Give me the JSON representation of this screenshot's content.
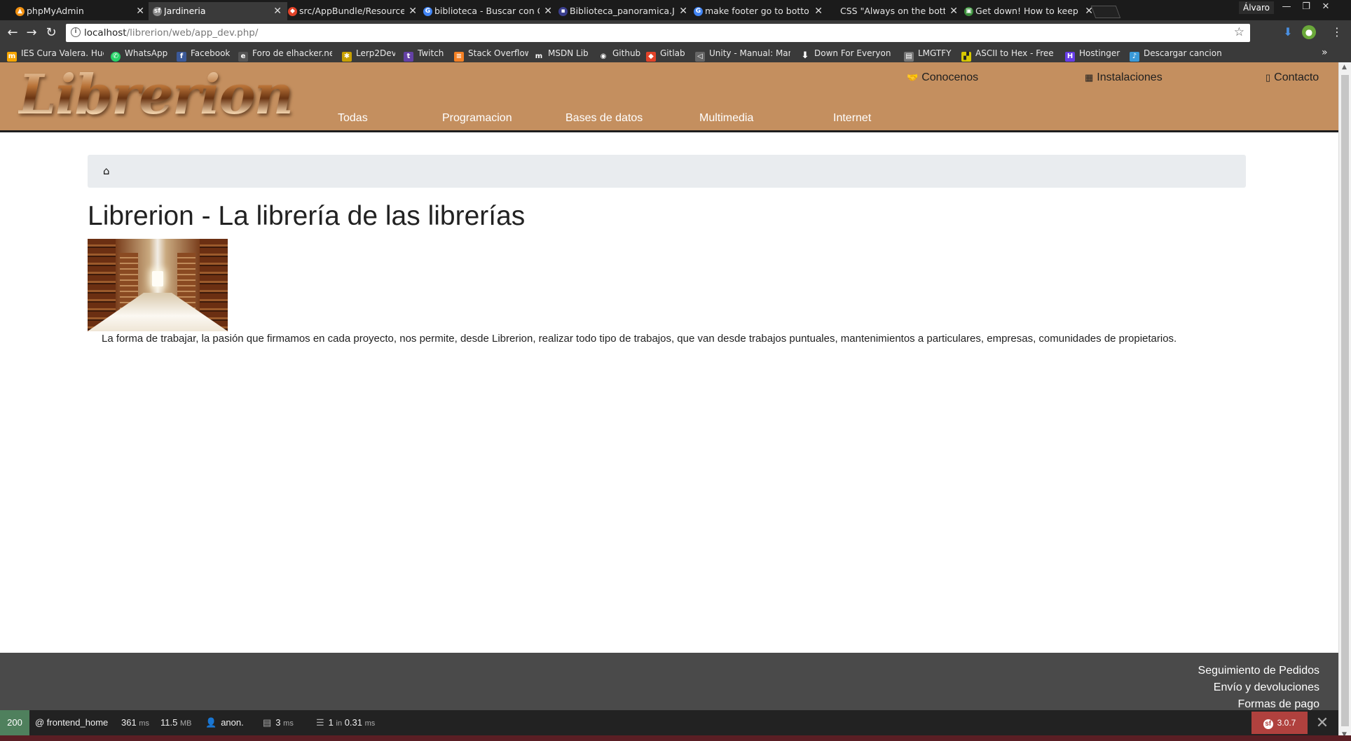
{
  "browser": {
    "tabs": [
      {
        "label": "phpMyAdmin",
        "icon": "phpmyadmin-icon",
        "color": "#f29111"
      },
      {
        "label": "Jardineria",
        "icon": "symfony-icon",
        "color": "#888888"
      },
      {
        "label": "src/AppBundle/Resource",
        "icon": "gitlab-icon",
        "color": "#e24329"
      },
      {
        "label": "biblioteca - Buscar con G",
        "icon": "google-icon",
        "color": "#4285f4"
      },
      {
        "label": "Biblioteca_panoramica.JI",
        "icon": "image-icon",
        "color": "#3b3f8f"
      },
      {
        "label": "make footer go to botto",
        "icon": "google-icon",
        "color": "#4285f4"
      },
      {
        "label": "CSS \"Always on the botto",
        "icon": "blank-icon",
        "color": "#1b1b1b"
      },
      {
        "label": "Get down! How to keep f",
        "icon": "site-icon",
        "color": "#3c8f3c"
      }
    ],
    "profile": "Álvaro",
    "url": {
      "host": "localhost",
      "path": "/librerion/web/app_dev.php/"
    },
    "bookmarks": [
      {
        "label": "IES Cura Valera. Huér",
        "icon": "m-icon",
        "color": "#f7a600"
      },
      {
        "label": "WhatsApp",
        "icon": "whatsapp-icon",
        "color": "#25d366"
      },
      {
        "label": "Facebook",
        "icon": "facebook-icon",
        "color": "#3b5998"
      },
      {
        "label": "Foro de elhacker.net",
        "icon": "e-icon",
        "color": "#555555"
      },
      {
        "label": "Lerp2Dev",
        "icon": "bug-icon",
        "color": "#c8a000"
      },
      {
        "label": "Twitch",
        "icon": "twitch-icon",
        "color": "#6441a5"
      },
      {
        "label": "Stack Overflow",
        "icon": "stackoverflow-icon",
        "color": "#f48024"
      },
      {
        "label": "MSDN Lib",
        "icon": "msdn-icon",
        "color": "#3a3a3a"
      },
      {
        "label": "Github",
        "icon": "github-icon",
        "color": "#3a3a3a"
      },
      {
        "label": "Gitlab",
        "icon": "gitlab-icon",
        "color": "#e24329"
      },
      {
        "label": "Unity - Manual: Manu",
        "icon": "unity-icon",
        "color": "#666666"
      },
      {
        "label": "Down For Everyone O",
        "icon": "down-arrow-icon",
        "color": "#3a3a3a"
      },
      {
        "label": "LMGTFY",
        "icon": "lmgtfy-icon",
        "color": "#777777"
      },
      {
        "label": "ASCII to Hex - Free to",
        "icon": "ascii-icon",
        "color": "#d8c800"
      },
      {
        "label": "Hostinger",
        "icon": "hostinger-icon",
        "color": "#673de6"
      },
      {
        "label": "Descargar canciones",
        "icon": "music-icon",
        "color": "#3a9ad9"
      }
    ]
  },
  "site": {
    "logo_text": "Librerion",
    "top_links": [
      {
        "label": "Conocenos",
        "icon": "handshake-icon"
      },
      {
        "label": "Instalaciones",
        "icon": "building-icon"
      },
      {
        "label": "Contacto",
        "icon": "phone-icon"
      }
    ],
    "categories": [
      "Todas",
      "Programacion",
      "Bases de datos",
      "Multimedia",
      "Internet"
    ],
    "colors": {
      "header": "#c48f5f",
      "footer": "#4a4a4a",
      "breadcrumb": "#e9ecef"
    }
  },
  "main": {
    "breadcrumb_icon": "home-icon",
    "title": "Librerion - La librería de las librerías",
    "image_alt": "Biblioteca panorámica",
    "intro": "La forma de trabajar, la pasión que firmamos en cada proyecto, nos permite, desde Librerion, realizar todo tipo de trabajos, que van desde trabajos puntuales, mantenimientos a particulares, empresas, comunidades de propietarios."
  },
  "footer": {
    "links": [
      "Seguimiento de Pedidos",
      "Envío y devoluciones",
      "Formas de pago"
    ]
  },
  "debug_toolbar": {
    "status": "200",
    "route": "@ frontend_home",
    "time_value": "361",
    "time_unit": "ms",
    "memory_value": "11.5",
    "memory_unit": "MB",
    "user": "anon.",
    "twig_value": "3",
    "twig_unit": "ms",
    "db_value": "1",
    "db_mid": "in",
    "db_time": "0.31",
    "db_unit": "ms",
    "version": "3.0.7"
  }
}
